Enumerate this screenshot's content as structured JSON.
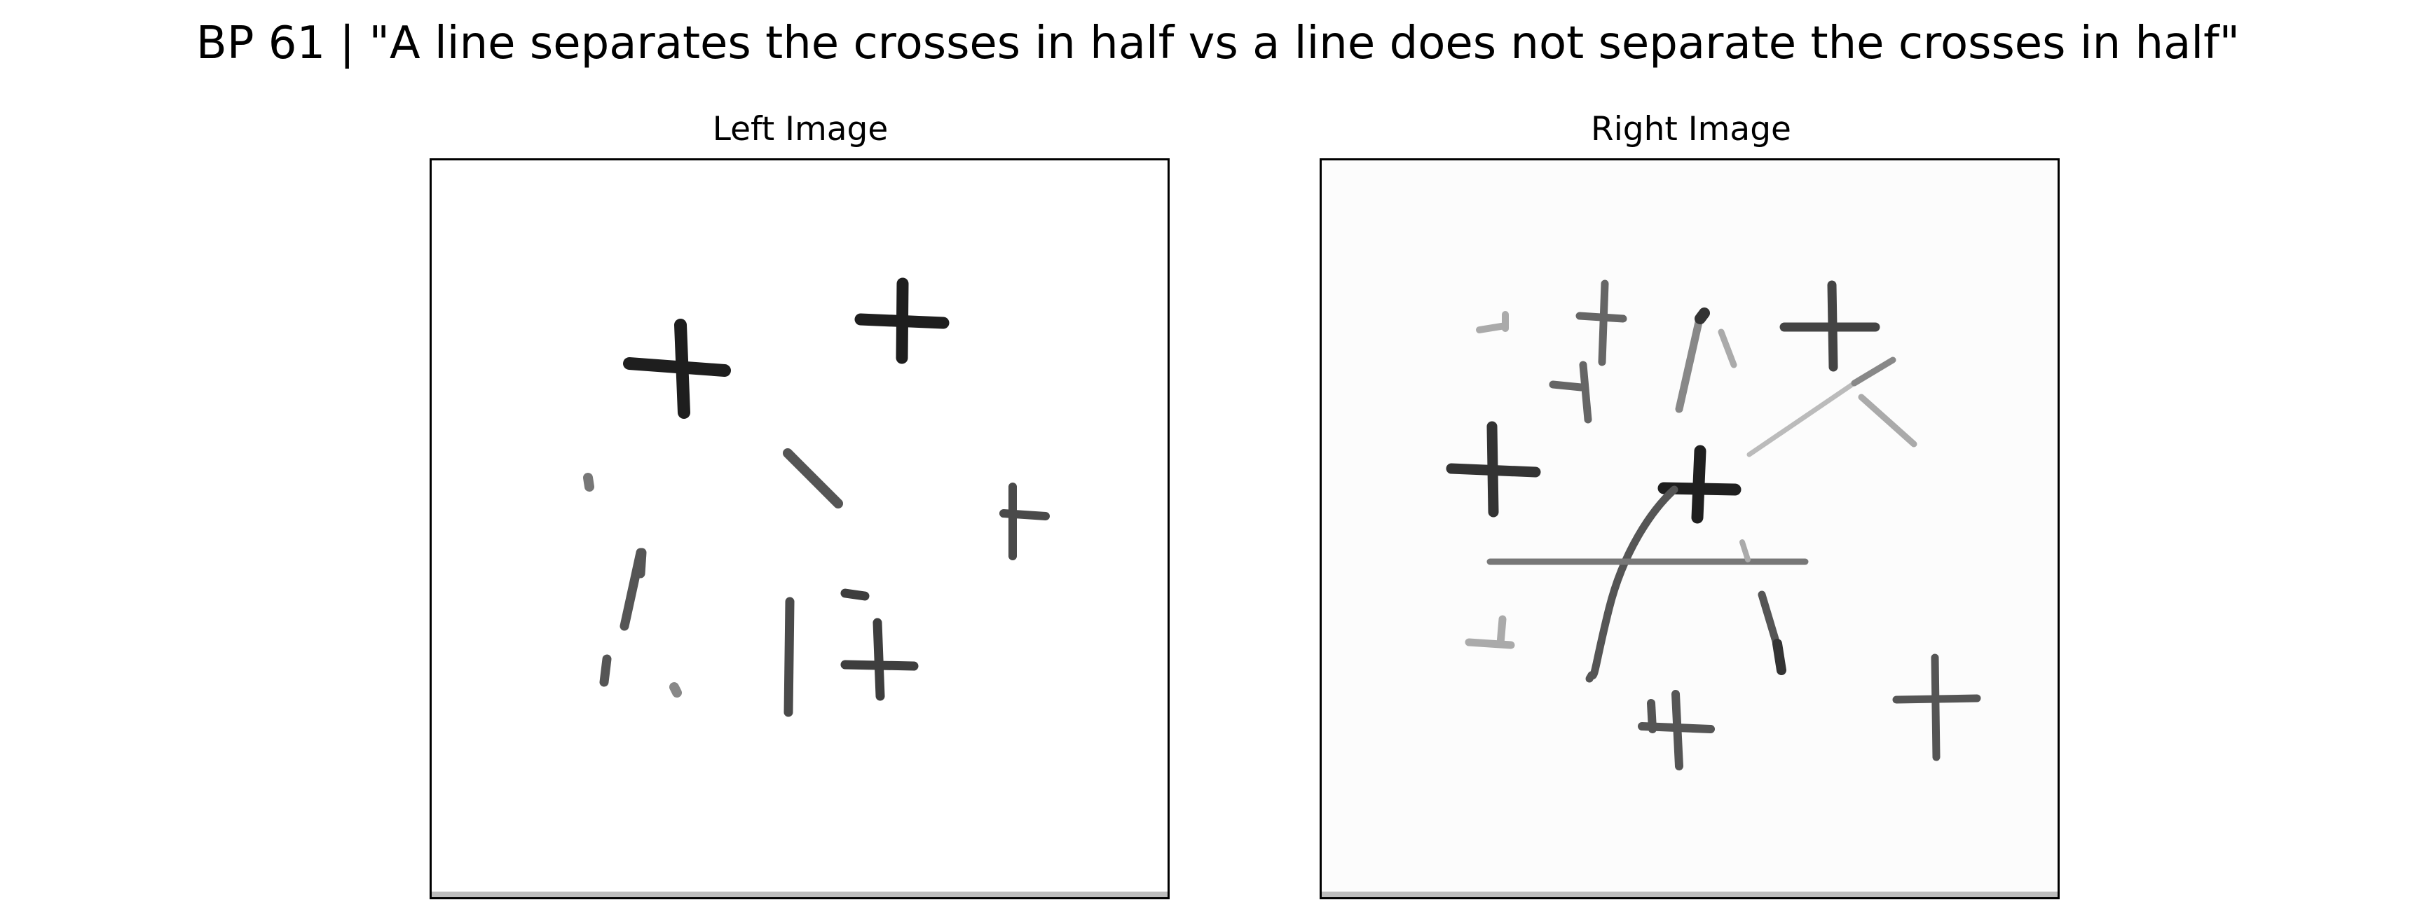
{
  "header": {
    "title": "BP 61 | \"A line separates the crosses in half vs a line does not separate the crosses in half\""
  },
  "panels": {
    "left": {
      "title": "Left Image",
      "background": "#ffffff",
      "stroke": "#2b2b2b"
    },
    "right": {
      "title": "Right Image",
      "background": "#fcfcfc",
      "stroke": "#3a3a3a"
    }
  },
  "colors": {
    "frame": "#000000",
    "ink": "#222222"
  }
}
